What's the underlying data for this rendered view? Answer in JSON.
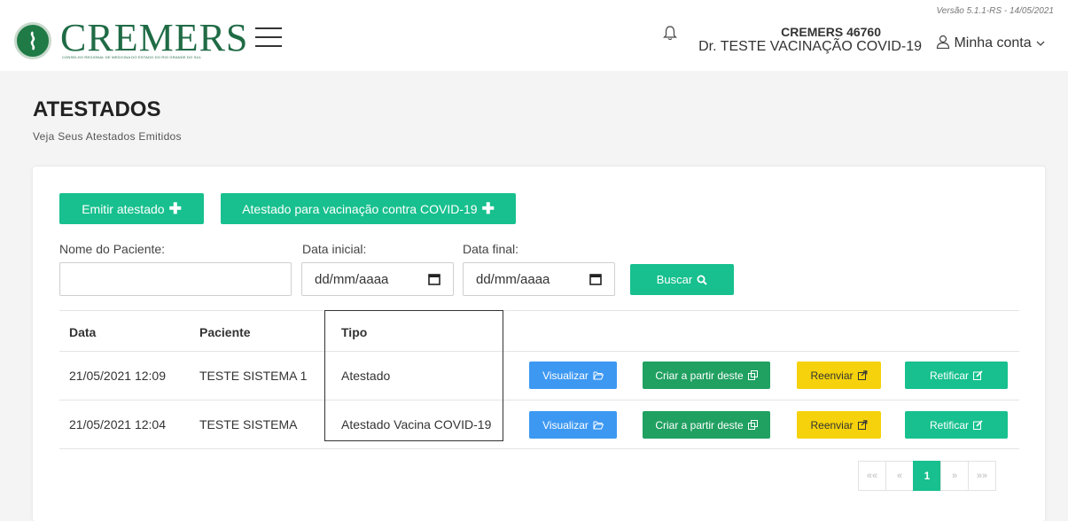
{
  "header": {
    "logo_text": "CREMERS",
    "logo_subtitle": "CONSELHO REGIONAL DE MEDICINA DO ESTADO DO RIO GRANDE DO SUL",
    "version": "Versão 5.1.1-RS - 14/05/2021",
    "user_crm": "CREMERS 46760",
    "user_name": "Dr. TESTE VACINAÇÃO COVID-19",
    "account_label": "Minha conta"
  },
  "page": {
    "title": "ATESTADOS",
    "subtitle": "Veja Seus Atestados Emitidos"
  },
  "actions": {
    "emit_label": "Emitir atestado",
    "covid_label": "Atestado para vacinação contra COVID-19"
  },
  "filters": {
    "patient_label": "Nome do Paciente:",
    "patient_value": "",
    "start_label": "Data inicial:",
    "start_placeholder": "dd/mm/aaaa",
    "end_label": "Data final:",
    "end_placeholder": "dd/mm/aaaa",
    "search_label": "Buscar"
  },
  "table": {
    "headers": [
      "Data",
      "Paciente",
      "Tipo"
    ],
    "rows": [
      {
        "date": "21/05/2021 12:09",
        "patient": "TESTE SISTEMA 1",
        "type": "Atestado",
        "view": "Visualizar",
        "create_from": "Criar a partir deste",
        "resend": "Reenviar",
        "rectify": "Retificar"
      },
      {
        "date": "21/05/2021 12:04",
        "patient": "TESTE SISTEMA",
        "type": "Atestado Vacina COVID-19",
        "view": "Visualizar",
        "create_from": "Criar a partir deste",
        "resend": "Reenviar",
        "rectify": "Retificar"
      }
    ]
  },
  "pagination": {
    "first": "««",
    "prev": "«",
    "current": "1",
    "next": "»",
    "last": "»»"
  },
  "colors": {
    "accent": "#17c08e",
    "create_button": "#20a061",
    "view_button": "#3d98f2",
    "resend_button": "#f5d20b",
    "brand": "#1f6b45"
  },
  "icons": [
    "seal-icon",
    "menu-icon",
    "bell-icon",
    "user-icon",
    "chevron-down-icon",
    "plus-icon",
    "calendar-icon",
    "search-icon",
    "folder-open-icon",
    "copy-icon",
    "share-icon",
    "edit-icon"
  ]
}
